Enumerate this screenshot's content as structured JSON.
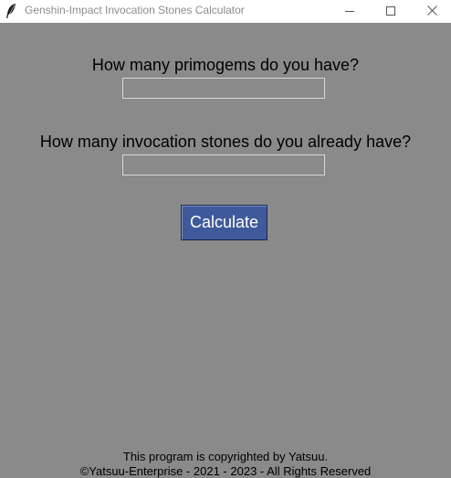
{
  "window": {
    "title": "Genshin-Impact Invocation Stones Calculator",
    "icon": "feather-icon",
    "controls": [
      "minimize-icon",
      "maximize-icon",
      "close-icon"
    ]
  },
  "form": {
    "primogems_label": "How many primogems do you have?",
    "primogems_value": "",
    "stones_label": "How many invocation stones do you already have?",
    "stones_value": "",
    "calculate_label": "Calculate"
  },
  "footer": {
    "line1": "This program is copyrighted by Yatsuu.",
    "line2": "©Yatsuu-Enterprise - 2021 - 2023 - All Rights Reserved"
  },
  "colors": {
    "background": "#8a8a8a",
    "button": "#3f5a9a",
    "button_text": "#ffffff"
  }
}
